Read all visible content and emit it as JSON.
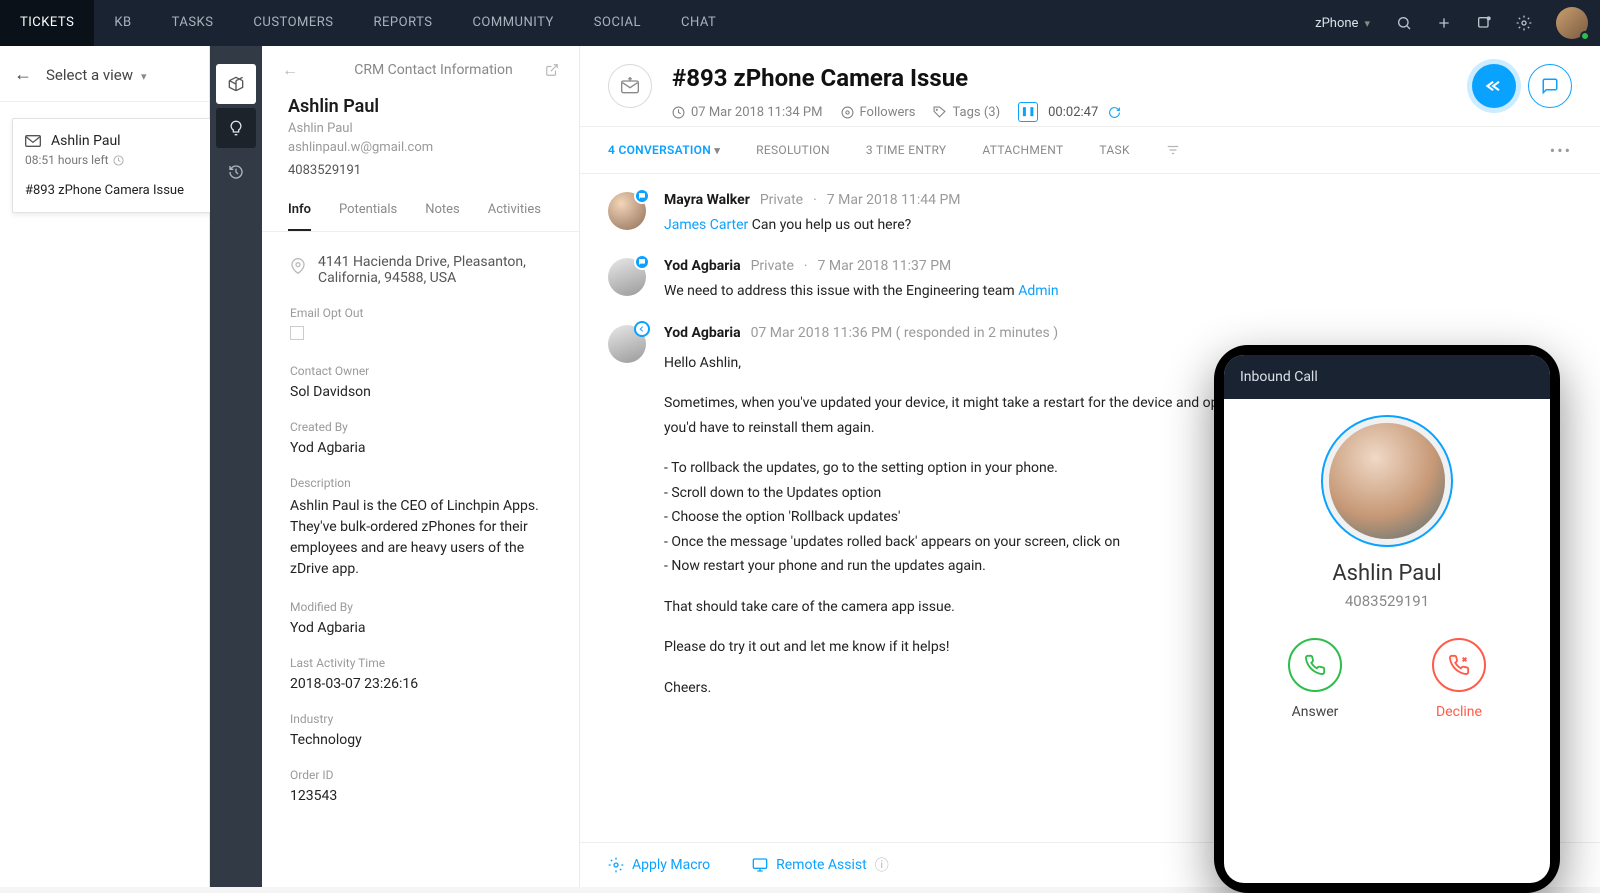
{
  "nav": {
    "items": [
      "TICKETS",
      "KB",
      "TASKS",
      "CUSTOMERS",
      "REPORTS",
      "COMMUNITY",
      "SOCIAL",
      "CHAT"
    ],
    "brand": "zPhone"
  },
  "left": {
    "view_select": "Select a view",
    "card": {
      "name": "Ashlin Paul",
      "hours": "08:51 hours left",
      "title": "#893   zPhone Camera Issue"
    }
  },
  "crm": {
    "header": "CRM Contact Information",
    "name": "Ashlin Paul",
    "sub_name": "Ashlin Paul",
    "email": "ashlinpaul.w@gmail.com",
    "phone": "4083529191",
    "tabs": [
      "Info",
      "Potentials",
      "Notes",
      "Activities"
    ],
    "address": "4141 Hacienda Drive, Pleasanton, California, 94588, USA",
    "fields": {
      "email_opt_out": "Email Opt Out",
      "contact_owner_lbl": "Contact Owner",
      "contact_owner_val": "Sol Davidson",
      "created_by_lbl": "Created By",
      "created_by_val": "Yod Agbaria",
      "description_lbl": "Description",
      "description_val": "Ashlin Paul is the CEO of Linchpin Apps. They've bulk-ordered zPhones for their employees and are heavy users of the zDrive app.",
      "modified_by_lbl": "Modified By",
      "modified_by_val": "Yod Agbaria",
      "last_activity_lbl": "Last Activity Time",
      "last_activity_val": "2018-03-07 23:26:16",
      "industry_lbl": "Industry",
      "industry_val": "Technology",
      "order_id_lbl": "Order ID",
      "order_id_val": "123543"
    }
  },
  "ticket": {
    "title": "#893  zPhone Camera Issue",
    "datetime": "07 Mar 2018 11:34 PM",
    "followers": "Followers",
    "tags": "Tags (3)",
    "timer": "00:02:47",
    "tabs": {
      "conversation": "4 CONVERSATION",
      "resolution": "RESOLUTION",
      "timeentry": "3 TIME ENTRY",
      "attachment": "ATTACHMENT",
      "task": "TASK"
    },
    "messages": [
      {
        "name": "Mayra Walker",
        "privacy": "Private",
        "date": "7 Mar 2018 11:44 PM",
        "mention": "James Carter",
        "text": " Can you help us out here?"
      },
      {
        "name": "Yod Agbaria",
        "privacy": "Private",
        "date": "7 Mar 2018 11:37 PM",
        "pretext": "We need to address this issue with the Engineering team ",
        "mention": "Admin"
      },
      {
        "name": "Yod Agbaria",
        "date": "07 Mar 2018 11:36 PM ( responded in 2 minutes )",
        "greeting": "Hello Ashlin,",
        "p1": "Sometimes, when you've updated your device, it might take a restart for the device and open the camera app now. If it still does not work, then you'd have to reinstall them again.",
        "b1": "- To rollback the updates, go to the setting option in your phone.",
        "b2": "- Scroll down to the Updates option",
        "b3": "- Choose the option 'Rollback updates'",
        "b4": "- Once the message 'updates rolled back' appears on your screen, click on",
        "b5": "- Now restart your phone and run the updates again.",
        "p2": "That should take care of the camera app issue.",
        "p3": "Please do try it out and let me know if it helps!",
        "p4": "Cheers."
      }
    ],
    "footer": {
      "macro": "Apply Macro",
      "remote": "Remote Assist"
    }
  },
  "call": {
    "label": "Inbound Call",
    "name": "Ashlin Paul",
    "number": "4083529191",
    "answer": "Answer",
    "decline": "Decline"
  }
}
